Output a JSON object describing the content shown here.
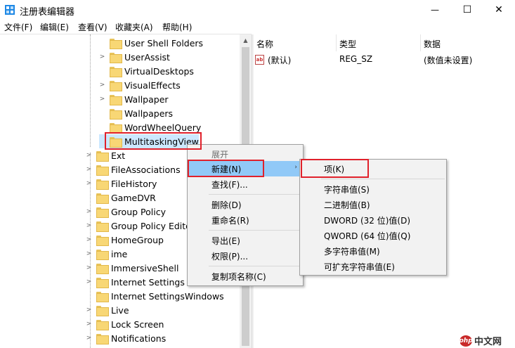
{
  "window": {
    "title": "注册表编辑器",
    "minimize_glyph": "—",
    "maximize_glyph": "☐",
    "close_glyph": "✕"
  },
  "menu": [
    "文件(F)",
    "编辑(E)",
    "查看(V)",
    "收藏夹(A)",
    "帮助(H)"
  ],
  "tree": {
    "items": [
      {
        "label": "User Shell Folders",
        "expandable": false
      },
      {
        "label": "UserAssist",
        "expandable": true
      },
      {
        "label": "VirtualDesktops",
        "expandable": false
      },
      {
        "label": "VisualEffects",
        "expandable": true
      },
      {
        "label": "Wallpaper",
        "expandable": true
      },
      {
        "label": "Wallpapers",
        "expandable": false
      },
      {
        "label": "WordWheelQuery",
        "expandable": false
      },
      {
        "label": "MultitaskingView",
        "expandable": false,
        "selected": true
      },
      {
        "label": "Ext",
        "expandable": true
      },
      {
        "label": "FileAssociations",
        "expandable": true
      },
      {
        "label": "FileHistory",
        "expandable": true
      },
      {
        "label": "GameDVR",
        "expandable": false
      },
      {
        "label": "Group Policy",
        "expandable": true
      },
      {
        "label": "Group Policy Editor",
        "expandable": true
      },
      {
        "label": "HomeGroup",
        "expandable": true
      },
      {
        "label": "ime",
        "expandable": true
      },
      {
        "label": "ImmersiveShell",
        "expandable": true
      },
      {
        "label": "Internet Settings",
        "expandable": true
      },
      {
        "label": "Internet SettingsWindows",
        "expandable": false
      },
      {
        "label": "Live",
        "expandable": true
      },
      {
        "label": "Lock Screen",
        "expandable": true
      },
      {
        "label": "Notifications",
        "expandable": true
      }
    ]
  },
  "list": {
    "columns": [
      "名称",
      "类型",
      "数据"
    ],
    "rows": [
      {
        "name": "(默认)",
        "type": "REG_SZ",
        "data": "(数值未设置)",
        "icon_text": "ab"
      }
    ]
  },
  "context_menu": {
    "items": [
      "展开",
      "新建(N)",
      "查找(F)...",
      "删除(D)",
      "重命名(R)",
      "导出(E)",
      "权限(P)...",
      "复制项名称(C)"
    ],
    "submenu_arrow": "›"
  },
  "submenu": {
    "items": [
      "项(K)",
      "字符串值(S)",
      "二进制值(B)",
      "DWORD (32 位)值(D)",
      "QWORD (64 位)值(Q)",
      "多字符串值(M)",
      "可扩充字符串值(E)"
    ]
  },
  "watermark": {
    "logo": "php",
    "text": "中文网"
  },
  "colors": {
    "highlight": "#91c9f7",
    "annotation": "#e0212b",
    "selection": "#cce8ff"
  }
}
